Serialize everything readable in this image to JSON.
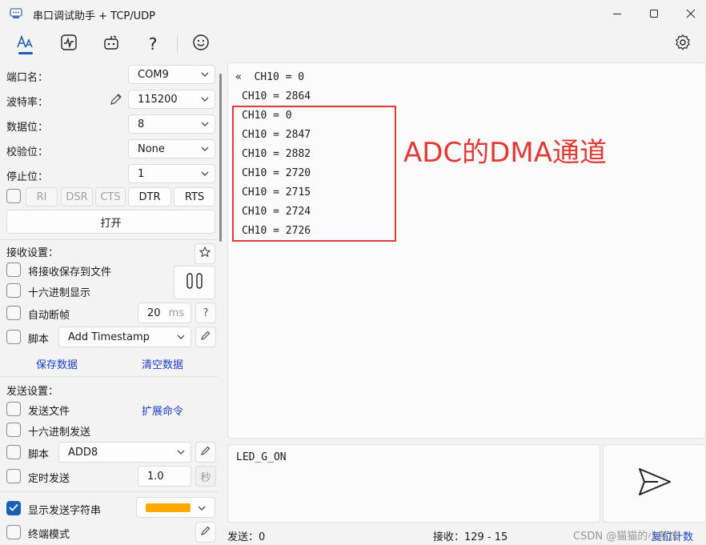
{
  "window": {
    "title": "串口调试助手 + TCP/UDP"
  },
  "port": {
    "port_label": "端口名：",
    "port_value": "COM9",
    "baud_label": "波特率：",
    "baud_value": "115200",
    "databits_label": "数据位：",
    "databits_value": "8",
    "parity_label": "校验位：",
    "parity_value": "None",
    "stopbits_label": "停止位：",
    "stopbits_value": "1",
    "signals": [
      "RI",
      "DSR",
      "CTS",
      "DTR",
      "RTS"
    ],
    "open_button": "打开"
  },
  "receive_settings": {
    "title": "接收设置：",
    "save_to_file": "将接收保存到文件",
    "hex_display": "十六进制显示",
    "auto_frame": "自动断帧",
    "frame_ms_value": "20",
    "frame_ms_unit": "ms",
    "help_glyph": "?",
    "script_label": "脚本",
    "script_value": "Add Timestamp",
    "save_data": "保存数据",
    "clear_data": "清空数据"
  },
  "send_settings": {
    "title": "发送设置：",
    "send_file": "发送文件",
    "ext_command": "扩展命令",
    "hex_send": "十六进制发送",
    "script_label": "脚本",
    "script_value": "ADD8",
    "timed_send": "定时发送",
    "timed_value": "1.0",
    "timed_unit": "秒",
    "show_send_string": "显示发送字符串",
    "send_color": "#ffaa00",
    "terminal_mode": "终端模式"
  },
  "receive_lines": [
    "«  CH10 = 0",
    "CH10 = 2864",
    "CH10 = 0",
    "CH10 = 2847",
    "CH10 = 2882",
    "CH10 = 2720",
    "CH10 = 2715",
    "CH10 = 2724",
    "CH10 = 2726"
  ],
  "annotation": "ADC的DMA通道",
  "send_text": "LED_G_ON",
  "status": {
    "send": "发送：0",
    "receive": "接收：129 - 15",
    "reset": "复位计数"
  },
  "watermark": "CSDN @猫猫的小茶馆"
}
